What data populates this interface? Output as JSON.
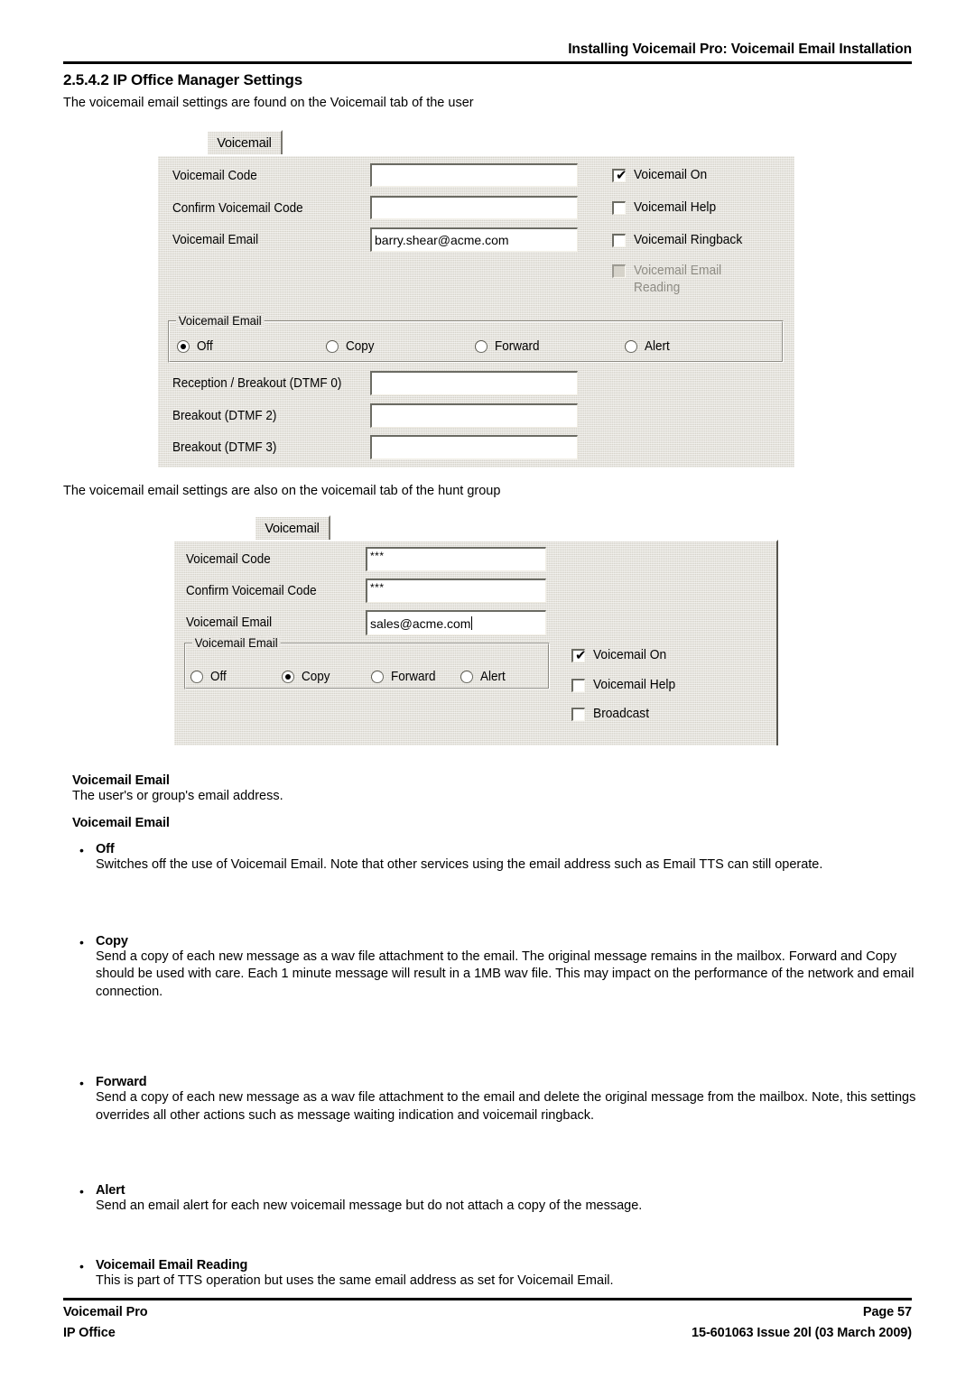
{
  "header": {
    "running_title": "Installing Voicemail Pro: Voicemail Email Installation"
  },
  "section": {
    "heading": "2.5.4.2 IP Office Manager Settings",
    "intro_user": "The voicemail email settings are found on the Voicemail tab of the user",
    "intro_group": "The voicemail email settings are also on the voicemail tab of the hunt group"
  },
  "user_dialog": {
    "tab_label": "Voicemail",
    "fields": [
      {
        "label": "Voicemail Code",
        "value": ""
      },
      {
        "label": "Confirm Voicemail Code",
        "value": ""
      },
      {
        "label": "Voicemail Email",
        "value": "barry.shear@acme.com"
      }
    ],
    "checkboxes": [
      {
        "label": "Voicemail On",
        "checked": true,
        "enabled": true
      },
      {
        "label": "Voicemail Help",
        "checked": false,
        "enabled": true
      },
      {
        "label": "Voicemail Ringback",
        "checked": false,
        "enabled": true
      },
      {
        "label": "Voicemail Email Reading",
        "checked": false,
        "enabled": false
      }
    ],
    "group": {
      "title": "Voicemail Email",
      "options": [
        "Off",
        "Copy",
        "Forward",
        "Alert"
      ],
      "selected": "Off"
    },
    "dtmf_fields": [
      {
        "label": "Reception / Breakout (DTMF 0)",
        "value": ""
      },
      {
        "label": "Breakout (DTMF 2)",
        "value": ""
      },
      {
        "label": "Breakout (DTMF 3)",
        "value": ""
      }
    ]
  },
  "group_dialog": {
    "tab_label": "Voicemail",
    "fields": [
      {
        "label": "Voicemail Code",
        "value": "***"
      },
      {
        "label": "Confirm Voicemail Code",
        "value": "***"
      },
      {
        "label": "Voicemail Email",
        "value": "sales@acme.com"
      }
    ],
    "checkboxes": [
      {
        "label": "Voicemail On",
        "checked": true,
        "enabled": true
      },
      {
        "label": "Voicemail Help",
        "checked": false,
        "enabled": true
      },
      {
        "label": "Broadcast",
        "checked": false,
        "enabled": true
      }
    ],
    "group": {
      "title": "Voicemail Email",
      "options": [
        "Off",
        "Copy",
        "Forward",
        "Alert"
      ],
      "selected": "Copy"
    }
  },
  "content": {
    "def_heading": "Voicemail Email",
    "def_text": "The user's or group's email address.",
    "list_heading": "Voicemail Email",
    "bullets": [
      {
        "label": "Off",
        "text": "Switches off the use of Voicemail Email. Note that other services using the email address such as Email TTS can still operate."
      },
      {
        "label": "Copy",
        "text": "Send a copy of each new message as a wav file attachment to the email. The original message remains in the mailbox. Forward and Copy should be used with care. Each 1 minute message will result in a 1MB wav file. This may impact on the performance of the network and email connection."
      },
      {
        "label": "Forward",
        "text": "Send a copy of each new message as a wav file attachment to the email and delete the original message from the mailbox. Note, this settings overrides all other actions such as message waiting indication and voicemail ringback."
      },
      {
        "label": "Alert",
        "text": "Send an email alert for each new voicemail message but do not attach a copy of the message."
      },
      {
        "label": "Voicemail Email Reading",
        "text": "This is part of TTS operation but uses the same email address as set for Voicemail Email."
      }
    ]
  },
  "footer": {
    "left_line1": "Voicemail Pro",
    "left_line2": "IP Office",
    "right_line1": "Page 57",
    "right_line2": "15-601063 Issue 20l (03 March 2009)"
  }
}
